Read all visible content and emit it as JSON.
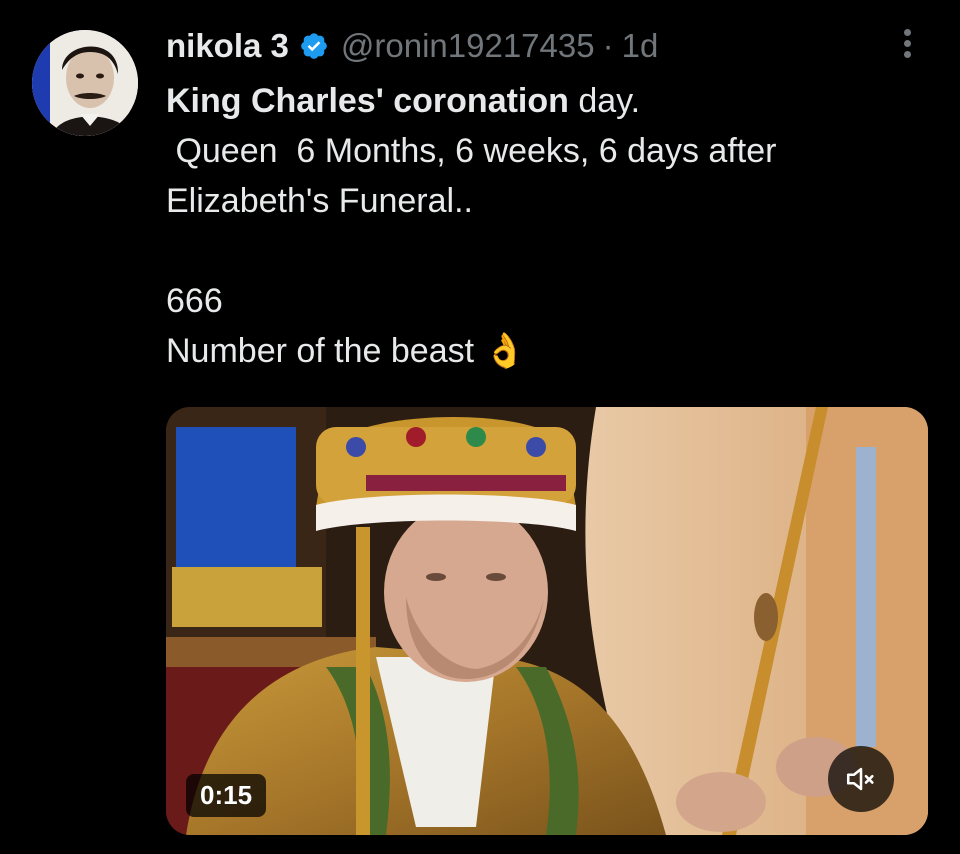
{
  "tweet": {
    "author_name": "nikola 3",
    "handle": "@ronin19217435",
    "separator": "·",
    "time": "1d",
    "text_line1_bold": "King Charles' coronation",
    "text_line1_rest": " day.",
    "text_line2": " Queen  6 Months, 6 weeks, 6 days after",
    "text_line3": "Elizabeth's Funeral..",
    "text_line4": "",
    "text_line5": "666",
    "text_line6": "Number of the beast",
    "emoji": "👌"
  },
  "media": {
    "duration": "0:15",
    "mute_icon": "speaker-muted-icon"
  },
  "icons": {
    "verified": "verified-badge-icon",
    "more": "more-dots-icon"
  },
  "colors": {
    "background": "#000000",
    "primary_text": "#e7e9ea",
    "secondary_text": "#71767b",
    "verified": "#1d9bf0"
  }
}
